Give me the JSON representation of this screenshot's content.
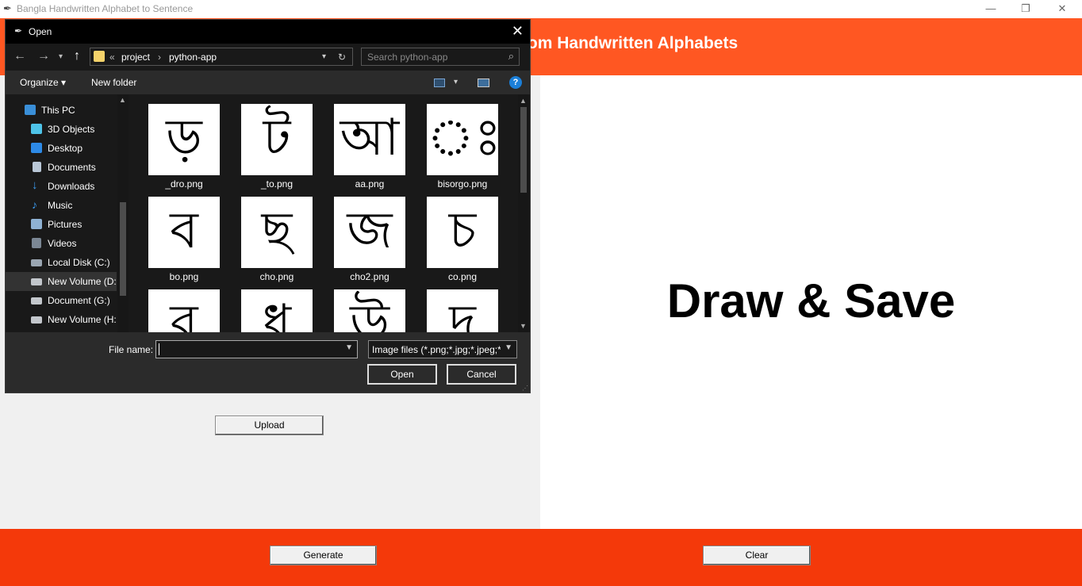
{
  "app": {
    "window_title": "Bangla Handwritten Alphabet to Sentence",
    "banner_title": "Sentence Generation from Handwritten Alphabets",
    "canvas_text": "Draw & Save",
    "upload_label": "Upload",
    "generate_label": "Generate",
    "clear_label": "Clear",
    "window_controls": {
      "minimize": "—",
      "restore": "❐",
      "close": "✕"
    }
  },
  "colors": {
    "banner": "#ff5722",
    "footer": "#f4390a",
    "dialog_bg": "#191919"
  },
  "dialog": {
    "title": "Open",
    "close_glyph": "✕",
    "breadcrumb": [
      "«",
      "project",
      "›",
      "python-app"
    ],
    "search_placeholder": "Search python-app",
    "organize_label": "Organize ▾",
    "new_folder_label": "New folder",
    "nav_items": [
      {
        "label": "This PC",
        "icon": "pc-icon"
      },
      {
        "label": "3D Objects",
        "icon": "cube-icon"
      },
      {
        "label": "Desktop",
        "icon": "desktop-icon"
      },
      {
        "label": "Documents",
        "icon": "document-icon"
      },
      {
        "label": "Downloads",
        "icon": "download-icon"
      },
      {
        "label": "Music",
        "icon": "music-icon"
      },
      {
        "label": "Pictures",
        "icon": "pictures-icon"
      },
      {
        "label": "Videos",
        "icon": "video-icon"
      },
      {
        "label": "Local Disk (C:)",
        "icon": "drive-icon"
      },
      {
        "label": "New Volume (D:",
        "icon": "drive-icon"
      },
      {
        "label": "Document (G:)",
        "icon": "drive-icon"
      },
      {
        "label": "New Volume (H:",
        "icon": "drive-icon"
      }
    ],
    "files": [
      {
        "name": "_dro.png",
        "glyph": "ড়"
      },
      {
        "name": "_to.png",
        "glyph": "ট"
      },
      {
        "name": "aa.png",
        "glyph": "আ"
      },
      {
        "name": "bisorgo.png",
        "glyph": "ঃ"
      },
      {
        "name": "bo.png",
        "glyph": "ব"
      },
      {
        "name": "cho.png",
        "glyph": "ছ"
      },
      {
        "name": "cho2.png",
        "glyph": "জ"
      },
      {
        "name": "co.png",
        "glyph": "চ"
      },
      {
        "name": "",
        "glyph": "র"
      },
      {
        "name": "",
        "glyph": "ধ"
      },
      {
        "name": "",
        "glyph": "উ"
      },
      {
        "name": "",
        "glyph": "দ"
      }
    ],
    "file_name_label": "File name:",
    "file_name_value": "",
    "filter_label": "Image files (*.png;*.jpg;*.jpeg;*",
    "open_label": "Open",
    "cancel_label": "Cancel",
    "help_glyph": "?"
  }
}
